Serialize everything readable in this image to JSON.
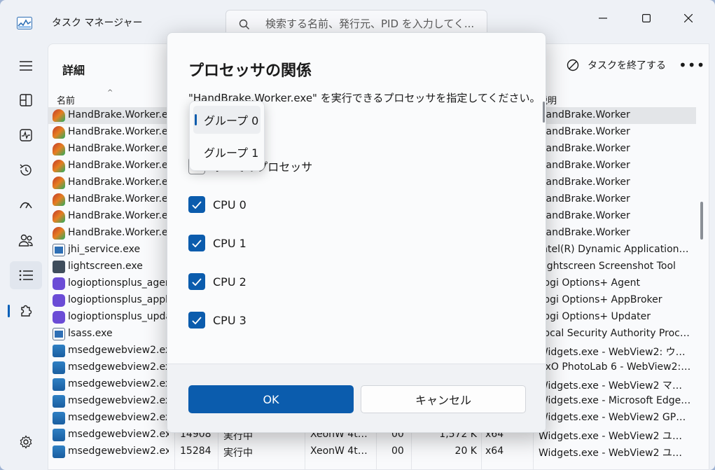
{
  "app": {
    "title": "タスク マネージャー"
  },
  "search": {
    "placeholder": "検索する名前、発行元、PID を入力してく..."
  },
  "page": {
    "title": "詳細",
    "end_task_label": "タスクを終了する",
    "more_label": "•••"
  },
  "columns": {
    "name": "名前",
    "description": "説明"
  },
  "rows": [
    {
      "name": "HandBrake.Worker.exe",
      "desc": "HandBrake.Worker",
      "icon": "handbrake-icon",
      "selected": true
    },
    {
      "name": "HandBrake.Worker.exe",
      "desc": "HandBrake.Worker",
      "icon": "handbrake-icon"
    },
    {
      "name": "HandBrake.Worker.exe",
      "desc": "HandBrake.Worker",
      "icon": "handbrake-icon"
    },
    {
      "name": "HandBrake.Worker.exe",
      "desc": "HandBrake.Worker",
      "icon": "handbrake-icon"
    },
    {
      "name": "HandBrake.Worker.exe",
      "desc": "HandBrake.Worker",
      "icon": "handbrake-icon"
    },
    {
      "name": "HandBrake.Worker.exe",
      "desc": "HandBrake.Worker",
      "icon": "handbrake-icon"
    },
    {
      "name": "HandBrake.Worker.exe",
      "desc": "HandBrake.Worker",
      "icon": "handbrake-icon"
    },
    {
      "name": "HandBrake.Worker.exe",
      "desc": "HandBrake.Worker",
      "icon": "handbrake-icon"
    },
    {
      "name": "jhi_service.exe",
      "desc": "Intel(R) Dynamic Application L...",
      "icon": "window-icon"
    },
    {
      "name": "lightscreen.exe",
      "desc": "Lightscreen Screenshot Tool",
      "icon": "lightscreen-icon"
    },
    {
      "name": "logioptionsplus_agent.exe",
      "desc": "Logi Options+ Agent",
      "icon": "logi-icon"
    },
    {
      "name": "logioptionsplus_appbroker.exe",
      "desc": "Logi Options+ AppBroker",
      "icon": "logi-icon"
    },
    {
      "name": "logioptionsplus_updater.exe",
      "desc": "Logi Options+ Updater",
      "icon": "logi-icon"
    },
    {
      "name": "lsass.exe",
      "desc": "Local Security Authority Process",
      "icon": "window-icon"
    },
    {
      "name": "msedgewebview2.exe",
      "desc": "Widgets.exe - WebView2: ウィジ...",
      "icon": "edge-webview-icon"
    },
    {
      "name": "msedgewebview2.exe",
      "desc": "ZxO PhotoLab 6 - WebView2: ...",
      "icon": "edge-webview-icon"
    },
    {
      "name": "msedgewebview2.exe",
      "desc": "Widgets.exe - WebView2 マネー...",
      "icon": "edge-webview-icon"
    },
    {
      "name": "msedgewebview2.exe",
      "desc": "Widgets.exe - Microsoft Edge ...",
      "icon": "edge-webview-icon"
    },
    {
      "name": "msedgewebview2.exe",
      "desc": "Widgets.exe - WebView2 GPU ...",
      "icon": "edge-webview-icon"
    },
    {
      "name": "msedgewebview2.exe",
      "pid": "14908",
      "status": "実行中",
      "user": "XeonW 4th ...",
      "cpu": "00",
      "mem": "1,572 K",
      "arch": "x64",
      "desc": "Widgets.exe - WebView2 ユーテ...",
      "icon": "edge-webview-icon"
    },
    {
      "name": "msedgewebview2.exe",
      "pid": "15284",
      "status": "実行中",
      "user": "XeonW 4th ...",
      "cpu": "00",
      "mem": "20 K",
      "arch": "x64",
      "desc": "Widgets.exe - WebView2 ユーテ...",
      "icon": "edge-webview-icon"
    }
  ],
  "dialog": {
    "title": "プロセッサの関係",
    "message": "\"HandBrake.Worker.exe\" を実行できるプロセッサを指定してください。",
    "all_processors_label": "すべてのプロセッサ",
    "cpus": [
      {
        "label": "CPU 0",
        "checked": true
      },
      {
        "label": "CPU 1",
        "checked": true
      },
      {
        "label": "CPU 2",
        "checked": true
      },
      {
        "label": "CPU 3",
        "checked": true
      }
    ],
    "ok_label": "OK",
    "cancel_label": "キャンセル"
  },
  "group_dropdown": {
    "options": [
      "グループ 0",
      "グループ 1"
    ],
    "selected_index": 0
  },
  "colors": {
    "accent": "#0b5cad",
    "selected_row": "#e3e5e8"
  }
}
